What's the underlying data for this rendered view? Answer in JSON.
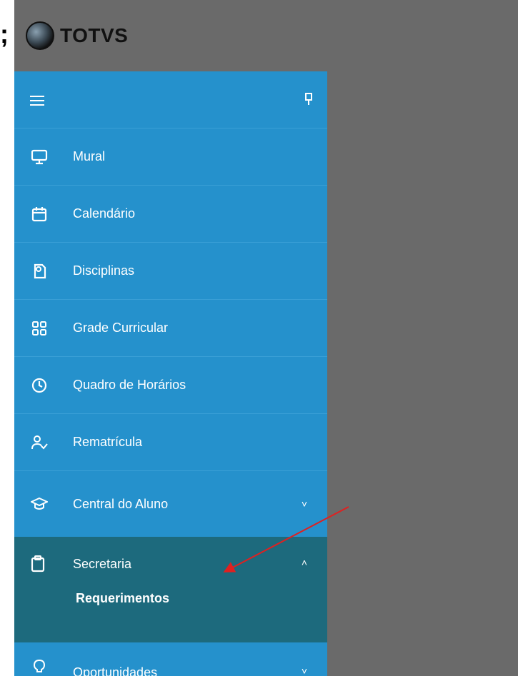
{
  "left_margin_glyph": ";",
  "brand": {
    "name": "TOTVS"
  },
  "sidebar": {
    "items": [
      {
        "label": "Mural",
        "icon": "monitor-icon"
      },
      {
        "label": "Calendário",
        "icon": "calendar-icon"
      },
      {
        "label": "Disciplinas",
        "icon": "book-icon"
      },
      {
        "label": "Grade Curricular",
        "icon": "grid-icon"
      },
      {
        "label": "Quadro de Horários",
        "icon": "clock-icon"
      },
      {
        "label": "Rematrícula",
        "icon": "user-check-icon"
      },
      {
        "label": "Central do Aluno",
        "icon": "graduation-cap-icon",
        "chevron": "˅"
      }
    ],
    "expanded_item": {
      "label": "Secretaria",
      "icon": "clipboard-icon",
      "chevron": "˄",
      "sub_items": [
        "Requerimentos"
      ]
    },
    "next_item": {
      "label": "Oportunidades",
      "icon": "lightbulb-icon",
      "chevron": "˅"
    }
  },
  "colors": {
    "sidebar_bg": "#2591cc",
    "expanded_bg": "#1d6a7d",
    "app_bg": "#6a6a6a",
    "annotation_arrow": "#e02020"
  }
}
